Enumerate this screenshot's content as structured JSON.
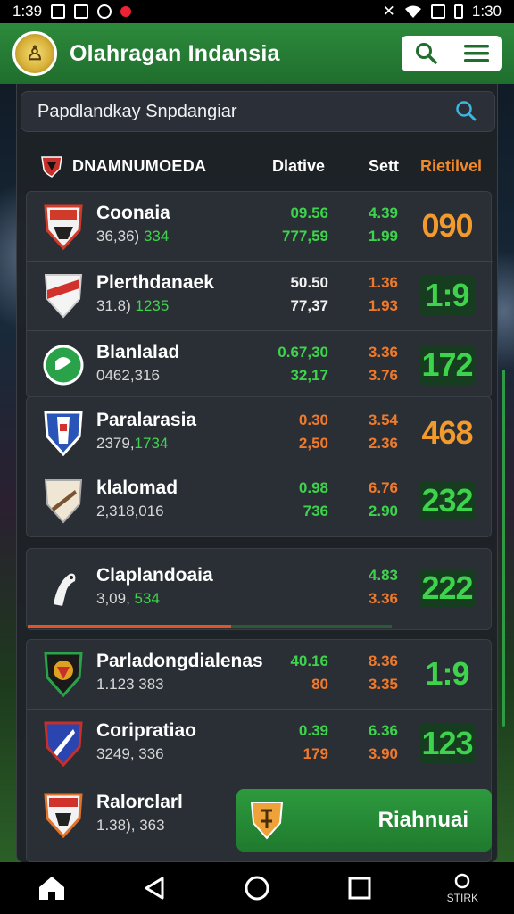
{
  "status_bar": {
    "time_left": "1:39",
    "time_right": "1:30"
  },
  "app": {
    "title": "Olahragan Indansia"
  },
  "search": {
    "text": "Papdlandkay Snpdangiar"
  },
  "table_header": {
    "title": "DNAMNUMOEDA",
    "col1": "Dlative",
    "col2": "Sett",
    "col3": "Rietilvel"
  },
  "groups": [
    {
      "rows": [
        {
          "name": "Coonaia",
          "meta_plain": "36,36) ",
          "meta_hl": "334",
          "odd1a": "09.56",
          "odd1b": "777,59",
          "odd2a": "4.39",
          "odd2b": "1.99",
          "score": "090",
          "score_style": "orange"
        },
        {
          "name": "Plerthdanaek",
          "meta_plain": "31.8) ",
          "meta_hl": "1235",
          "odd1a": "50.50",
          "odd1b": "77,37",
          "odd2a": "1.36",
          "odd2b": "1.93",
          "score": "1:9",
          "score_style": "green"
        },
        {
          "name": "Blanlalad",
          "meta_plain": "0462,316",
          "meta_hl": "",
          "odd1a": "0.67,30",
          "odd1b": "32,17",
          "odd2a": "3.36",
          "odd2b": "3.76",
          "score": "172",
          "score_style": "green"
        }
      ]
    },
    {
      "rows": [
        {
          "name": "Paralarasia",
          "meta_plain": "2379,",
          "meta_hl": "1734",
          "odd1a": "0.30",
          "odd1b": "2,50",
          "odd2a": "3.54",
          "odd2b": "2.36",
          "score": "468",
          "score_style": "orange"
        },
        {
          "name": "klalomad",
          "meta_plain": "2,318,016",
          "meta_hl": "",
          "odd1a": "0.98",
          "odd1b": "736",
          "odd2a": "6.76",
          "odd2b": "2.90",
          "score": "232",
          "score_style": "green"
        }
      ]
    },
    {
      "rows": [
        {
          "name": "Claplandoaia",
          "meta_plain": "3,09, ",
          "meta_hl": "534",
          "odd1a": "",
          "odd1b": "",
          "odd2a": "4.83",
          "odd2b": "3.36",
          "score": "222",
          "score_style": "green"
        }
      ]
    },
    {
      "rows": [
        {
          "name": "Parladongdialenas",
          "meta_plain": "1.123 383",
          "meta_hl": "",
          "odd1a": "40.16",
          "odd1b": "80",
          "odd2a": "8.36",
          "odd2b": "3.35",
          "score": "1:9",
          "score_style": "green"
        },
        {
          "name": "Coripratiao",
          "meta_plain": "3249, 336",
          "meta_hl": "",
          "odd1a": "0.39",
          "odd1b": "179",
          "odd2a": "6.36",
          "odd2b": "3.90",
          "score": "123",
          "score_style": "green"
        },
        {
          "name": "Ralorclarl",
          "meta_plain": "1.38), 363",
          "meta_hl": "",
          "odd1a": "",
          "odd1b": "",
          "odd2a": "",
          "odd2b": "",
          "score": "",
          "score_style": "none"
        }
      ]
    }
  ],
  "progress": {
    "fraction": 0.56
  },
  "cta": {
    "label": "Riahnuai"
  },
  "nav": {
    "recents_label": "STIRK"
  },
  "colors": {
    "brand_green": "#1f7a2e",
    "odds_green": "#3ed34c",
    "odds_orange": "#f07a2c",
    "panel": "#1e2228"
  }
}
